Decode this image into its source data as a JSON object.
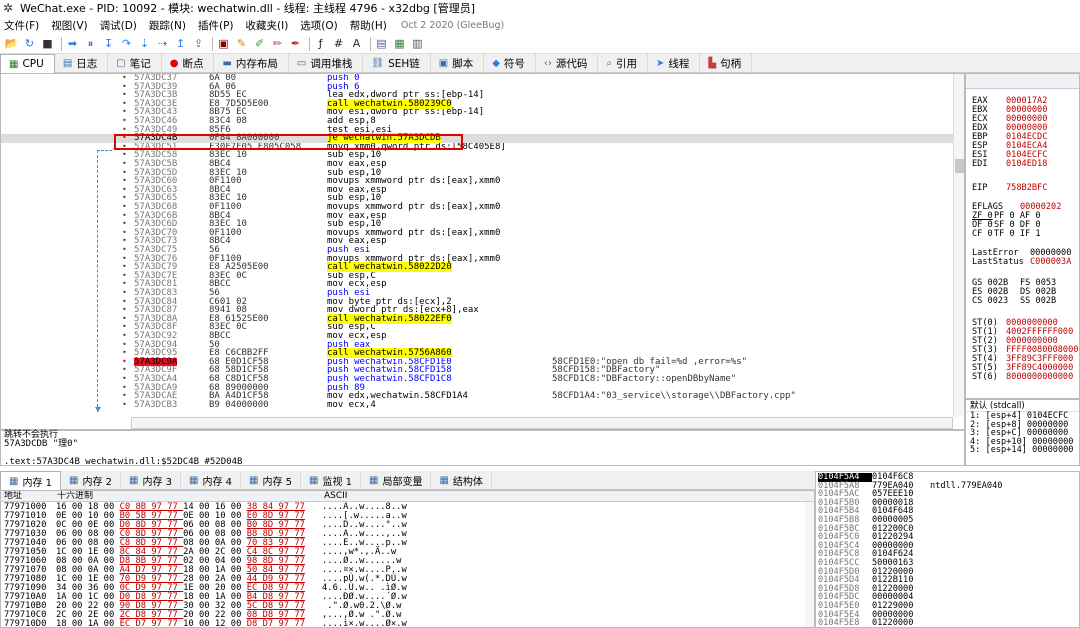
{
  "window": {
    "title": "WeChat.exe - PID: 10092 - 模块: wechatwin.dll - 线程: 主线程 4796 - x32dbg [管理员]",
    "icon": "bug-icon"
  },
  "menu": [
    "文件(F)",
    "视图(V)",
    "调试(D)",
    "跟踪(N)",
    "插件(P)",
    "收藏夹(I)",
    "选项(O)",
    "帮助(H)"
  ],
  "version": "Oct 2 2020 (GleeBug)",
  "toolbar": [
    "folder-open-icon",
    "restart-icon",
    "close-icon",
    "run-icon",
    "pause-icon",
    "step-into-icon",
    "step-over-icon",
    "trace-into-icon",
    "trace-over-icon",
    "execute-till-return-icon",
    "run-to-user-code-icon",
    "scylla-icon",
    "patch-icon",
    "comment-icon",
    "label-icon",
    "bookmark-icon",
    "function-icon",
    "hash-icon",
    "string-icon",
    "calculator-icon",
    "memory-icon",
    "script-icon"
  ],
  "tabs": [
    {
      "label": "CPU",
      "icon": "cpu-icon",
      "active": true
    },
    {
      "label": "日志",
      "icon": "log-icon"
    },
    {
      "label": "笔记",
      "icon": "notes-icon"
    },
    {
      "label": "断点",
      "icon": "breakpoint-icon"
    },
    {
      "label": "内存布局",
      "icon": "memory-map-icon"
    },
    {
      "label": "调用堆栈",
      "icon": "callstack-icon"
    },
    {
      "label": "SEH链",
      "icon": "seh-icon"
    },
    {
      "label": "脚本",
      "icon": "script-icon"
    },
    {
      "label": "符号",
      "icon": "symbol-icon"
    },
    {
      "label": "源代码",
      "icon": "source-icon"
    },
    {
      "label": "引用",
      "icon": "search-icon"
    },
    {
      "label": "线程",
      "icon": "thread-icon"
    },
    {
      "label": "句柄",
      "icon": "handle-icon"
    }
  ],
  "disasm": [
    {
      "addr": "57A3DC37",
      "bytes": "6A 00",
      "ins": "push 0",
      "kind": "push"
    },
    {
      "addr": "57A3DC39",
      "bytes": "6A 06",
      "ins": "push 6",
      "kind": "push"
    },
    {
      "addr": "57A3DC3B",
      "bytes": "8D55 EC",
      "ins": "lea edx,dword ptr ss:[ebp-14]"
    },
    {
      "addr": "57A3DC3E",
      "bytes": "E8 7D5D5E00",
      "ins": "call wechatwin.580239C0",
      "kind": "call"
    },
    {
      "addr": "57A3DC43",
      "bytes": "8B75 EC",
      "ins": "mov esi,dword ptr ss:[ebp-14]"
    },
    {
      "addr": "57A3DC46",
      "bytes": "83C4 08",
      "ins": "add esp,8"
    },
    {
      "addr": "57A3DC49",
      "bytes": "85F6",
      "ins": "test esi,esi"
    },
    {
      "addr": "57A3DC4B",
      "bytes": "0F84 8A000000",
      "ins": "je wechatwin.57A3DCDB",
      "kind": "jump",
      "current": true,
      "bp": true
    },
    {
      "addr": "57A3DC51",
      "bytes": "F30F7E05 E805C058",
      "ins": "movq xmm0,qword ptr ds:[58C405E8]"
    },
    {
      "addr": "57A3DC58",
      "bytes": "83EC 10",
      "ins": "sub esp,10"
    },
    {
      "addr": "57A3DC5B",
      "bytes": "8BC4",
      "ins": "mov eax,esp"
    },
    {
      "addr": "57A3DC5D",
      "bytes": "83EC 10",
      "ins": "sub esp,10"
    },
    {
      "addr": "57A3DC60",
      "bytes": "0F1100",
      "ins": "movups xmmword ptr ds:[eax],xmm0"
    },
    {
      "addr": "57A3DC63",
      "bytes": "8BC4",
      "ins": "mov eax,esp"
    },
    {
      "addr": "57A3DC65",
      "bytes": "83EC 10",
      "ins": "sub esp,10"
    },
    {
      "addr": "57A3DC68",
      "bytes": "0F1100",
      "ins": "movups xmmword ptr ds:[eax],xmm0"
    },
    {
      "addr": "57A3DC6B",
      "bytes": "8BC4",
      "ins": "mov eax,esp"
    },
    {
      "addr": "57A3DC6D",
      "bytes": "83EC 10",
      "ins": "sub esp,10"
    },
    {
      "addr": "57A3DC70",
      "bytes": "0F1100",
      "ins": "movups xmmword ptr ds:[eax],xmm0"
    },
    {
      "addr": "57A3DC73",
      "bytes": "8BC4",
      "ins": "mov eax,esp"
    },
    {
      "addr": "57A3DC75",
      "bytes": "56",
      "ins": "push esi",
      "kind": "push"
    },
    {
      "addr": "57A3DC76",
      "bytes": "0F1100",
      "ins": "movups xmmword ptr ds:[eax],xmm0"
    },
    {
      "addr": "57A3DC79",
      "bytes": "E8 A2505E00",
      "ins": "call wechatwin.58022D20",
      "kind": "call"
    },
    {
      "addr": "57A3DC7E",
      "bytes": "83EC 0C",
      "ins": "sub esp,C"
    },
    {
      "addr": "57A3DC81",
      "bytes": "8BCC",
      "ins": "mov ecx,esp"
    },
    {
      "addr": "57A3DC83",
      "bytes": "56",
      "ins": "push esi",
      "kind": "push"
    },
    {
      "addr": "57A3DC84",
      "bytes": "C601 02",
      "ins": "mov byte ptr ds:[ecx],2"
    },
    {
      "addr": "57A3DC87",
      "bytes": "8941 08",
      "ins": "mov dword ptr ds:[ecx+8],eax"
    },
    {
      "addr": "57A3DC8A",
      "bytes": "E8 6152SE00",
      "ins": "call wechatwin.58022EF0",
      "kind": "call"
    },
    {
      "addr": "57A3DC8F",
      "bytes": "83EC 0C",
      "ins": "sub esp,C"
    },
    {
      "addr": "57A3DC92",
      "bytes": "8BCC",
      "ins": "mov ecx,esp"
    },
    {
      "addr": "57A3DC94",
      "bytes": "50",
      "ins": "push eax",
      "kind": "push"
    },
    {
      "addr": "57A3DC95",
      "bytes": "E8 C6CBB2FF",
      "ins": "call wechatwin.5756A860",
      "kind": "call"
    },
    {
      "addr": "57A3DC9A",
      "bytes": "68 E0D1CF58",
      "ins": "push wechatwin.58CFD1E0",
      "kind": "push",
      "bp": true,
      "cmt": "58CFD1E0:\"open db fail=%d ,error=%s\""
    },
    {
      "addr": "57A3DC9F",
      "bytes": "68 58D1CF58",
      "ins": "push wechatwin.58CFD158",
      "kind": "push",
      "cmt": "58CFD158:\"DBFactory\""
    },
    {
      "addr": "57A3DCA4",
      "bytes": "68 C8D1CF58",
      "ins": "push wechatwin.58CFD1C8",
      "kind": "push",
      "cmt": "58CFD1C8:\"DBFactory::openDBbyName\""
    },
    {
      "addr": "57A3DCA9",
      "bytes": "68 89000000",
      "ins": "push 89",
      "kind": "push"
    },
    {
      "addr": "57A3DCAE",
      "bytes": "BA A4D1CF58",
      "ins": "mov edx,wechatwin.58CFD1A4",
      "cmt": "58CFD1A4:\"03_service\\\\storage\\\\DBFactory.cpp\""
    },
    {
      "addr": "57A3DCB3",
      "bytes": "B9 04000000",
      "ins": "mov ecx,4"
    }
  ],
  "registers": [
    {
      "n": "EAX",
      "v": "000017A2"
    },
    {
      "n": "EBX",
      "v": "00000000"
    },
    {
      "n": "ECX",
      "v": "00000000"
    },
    {
      "n": "EDX",
      "v": "00000000"
    },
    {
      "n": "EBP",
      "v": "0104ECDC"
    },
    {
      "n": "ESP",
      "v": "0104ECA4"
    },
    {
      "n": "ESI",
      "v": "0104ECFC"
    },
    {
      "n": "EDI",
      "v": "0104ED18"
    },
    {
      "n": "EIP",
      "v": "758B2BFC"
    },
    {
      "n": "EFLAGS",
      "v": "00000202"
    },
    {
      "n": "ZF 0",
      "v": "PF 0  AF 0"
    },
    {
      "n": "OF 0",
      "v": "SF 0  DF 0"
    },
    {
      "n": "CF 0",
      "v": "TF 0  IF 1"
    },
    {
      "n": "LastError",
      "v": "00000000"
    },
    {
      "n": "LastStatus",
      "v": "C000003A"
    },
    {
      "n": "GS 002B",
      "v": "FS 0053"
    },
    {
      "n": "ES 002B",
      "v": "DS 002B"
    },
    {
      "n": "CS 0023",
      "v": "SS 002B"
    },
    {
      "n": "ST(0)",
      "v": "0000000000"
    },
    {
      "n": "ST(1)",
      "v": "4002FFFFFF000"
    },
    {
      "n": "ST(2)",
      "v": "0000000000"
    },
    {
      "n": "ST(3)",
      "v": "FFFF0080008000"
    },
    {
      "n": "ST(4)",
      "v": "3FF89C3FFF000"
    },
    {
      "n": "ST(5)",
      "v": "3FF89C4000000"
    },
    {
      "n": "ST(6)",
      "v": "8000000000000"
    }
  ],
  "callconv": {
    "label": "默认 (stdcall)",
    "args": [
      "1: [esp+4] 0104ECFC",
      "2: [esp+8] 00000000",
      "3: [esp+C] 00000000",
      "4: [esp+10] 00000000",
      "5: [esp+14] 00000000"
    ]
  },
  "info": {
    "line1": "跳转不会执行",
    "line2": "57A3DCDB \"理0\"",
    "line3": ".text:57A3DC4B wechatwin.dll:$52DC4B #52D04B"
  },
  "memtabs": [
    {
      "label": "内存 1",
      "icon": "memory-icon",
      "active": true
    },
    {
      "label": "内存 2",
      "icon": "memory-icon"
    },
    {
      "label": "内存 3",
      "icon": "memory-icon"
    },
    {
      "label": "内存 4",
      "icon": "memory-icon"
    },
    {
      "label": "内存 5",
      "icon": "memory-icon"
    },
    {
      "label": "监视 1",
      "icon": "watch-icon"
    },
    {
      "label": "局部变量",
      "icon": "locals-icon"
    },
    {
      "label": "结构体",
      "icon": "struct-icon"
    }
  ],
  "mem_head": {
    "addr": "地址",
    "hex": "十六进制",
    "ascii": "ASCII"
  },
  "memory": [
    {
      "a": "77971000",
      "h": "16 00 18 00 C0 8B 97 77 14 00 16 00 38 84 97 77",
      "s": "....A..w....8..w"
    },
    {
      "a": "77971010",
      "h": "0E 00 10 00 B0 5B 97 77 0E 00 10 00 E0 8D 97 77",
      "s": "....[.w.....a..w"
    },
    {
      "a": "77971020",
      "h": "0C 00 0E 00 D0 8D 97 77 06 00 08 00 B0 8D 97 77",
      "s": "....D..w....°..w"
    },
    {
      "a": "77971030",
      "h": "06 00 08 00 C0 8D 97 77 06 00 08 00 B8 8D 97 77",
      "s": "....A..w....,..w"
    },
    {
      "a": "77971040",
      "h": "06 00 08 00 C8 8D 97 77 08 00 0A 00 70 83 97 77",
      "s": "....E..w....p..w"
    },
    {
      "a": "77971050",
      "h": "1C 00 1E 00 8C 84 97 77 2A 00 2C 00 C4 8C 97 77",
      "s": "....‚w*.,.Ä..w"
    },
    {
      "a": "77971060",
      "h": "08 00 0A 00 D8 8B 97 77 02 00 04 00 98 8D 97 77",
      "s": "....Ø..w......w"
    },
    {
      "a": "77971070",
      "h": "08 00 0A 00 A4 D7 97 77 18 00 1A 00 50 84 97 77",
      "s": "....¤×.w....P..w"
    },
    {
      "a": "77971080",
      "h": "1C 00 1E 00 70 D9 97 77 28 00 2A 00 44 D9 97 77",
      "s": "....pÙ.w(.*.DÙ.w"
    },
    {
      "a": "77971090",
      "h": "34 00 36 00 0C D9 97 77 1E 00 20 00 EC D8 97 77",
      "s": "4.6..Ù.w.. .ìØ.w"
    },
    {
      "a": "779710A0",
      "h": "1A 00 1C 00 D0 D8 97 77 18 00 1A 00 B4 D8 97 77",
      "s": "....ĐØ.w....´Ø.w"
    },
    {
      "a": "779710B0",
      "h": "20 00 22 00 90 D8 97 77 30 00 32 00 5C D8 97 77",
      "s": " .\".Ø.w0.2.\\Ø.w"
    },
    {
      "a": "779710C0",
      "h": "2C 00 2E 00 2C D8 97 77 20 00 22 00 08 D8 97 77",
      "s": ",...,Ø.w .\".Ø.w"
    },
    {
      "a": "779710D0",
      "h": "18 00 1A 00 EC D7 97 77 10 00 12 00 D8 D7 97 77",
      "s": "....ì×.w....Ø×.w"
    }
  ],
  "stack": [
    {
      "a": "0104F5A4",
      "v": "0104F6C8",
      "c": "",
      "top": true
    },
    {
      "a": "0104F5A8",
      "v": "779EA040",
      "c": "ntdll.779EA040"
    },
    {
      "a": "0104F5AC",
      "v": "057EEE10",
      "c": ""
    },
    {
      "a": "0104F5B0",
      "v": "00000018",
      "c": ""
    },
    {
      "a": "0104F5B4",
      "v": "0104F648",
      "c": ""
    },
    {
      "a": "0104F5B8",
      "v": "00000005",
      "c": ""
    },
    {
      "a": "0104F5BC",
      "v": "012200C0",
      "c": ""
    },
    {
      "a": "0104F5C0",
      "v": "01220294",
      "c": ""
    },
    {
      "a": "0104F5C4",
      "v": "00000000",
      "c": ""
    },
    {
      "a": "0104F5C8",
      "v": "0104F624",
      "c": ""
    },
    {
      "a": "0104F5CC",
      "v": "50000163",
      "c": ""
    },
    {
      "a": "0104F5D0",
      "v": "01220000",
      "c": ""
    },
    {
      "a": "0104F5D4",
      "v": "0122B110",
      "c": ""
    },
    {
      "a": "0104F5D8",
      "v": "01220000",
      "c": ""
    },
    {
      "a": "0104F5DC",
      "v": "00000004",
      "c": ""
    },
    {
      "a": "0104F5E0",
      "v": "01229000",
      "c": ""
    },
    {
      "a": "0104F5E4",
      "v": "00000000",
      "c": ""
    },
    {
      "a": "0104F5E8",
      "v": "01220000",
      "c": ""
    }
  ]
}
